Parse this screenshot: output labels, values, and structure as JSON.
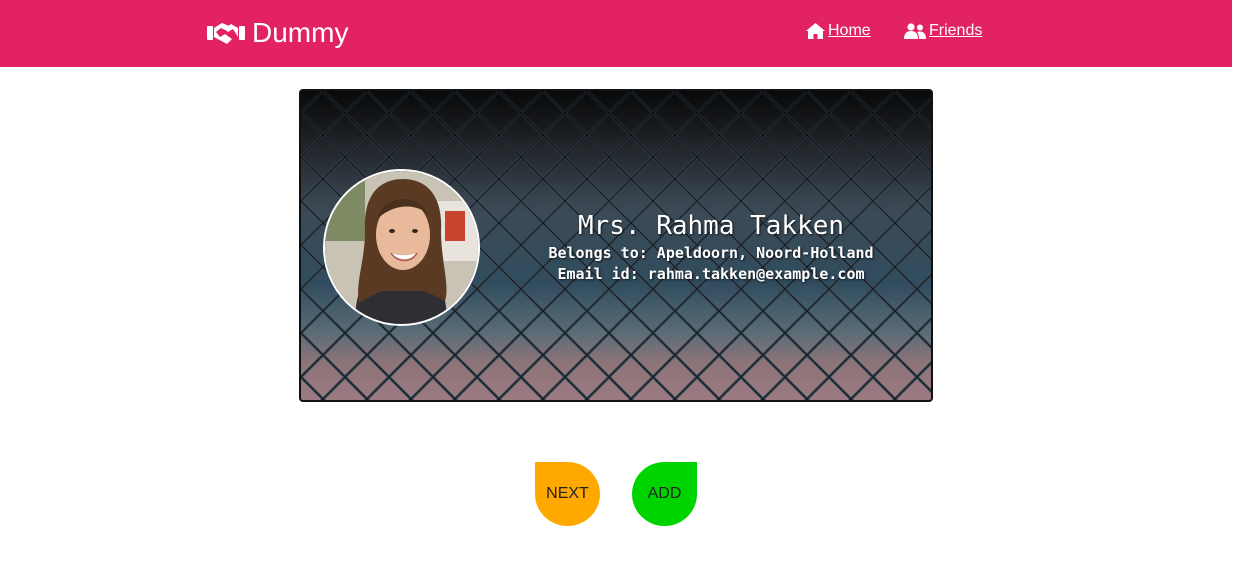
{
  "nav": {
    "brand_icon": "handshake-icon",
    "brand": "Dummy",
    "links": [
      {
        "icon": "home-icon",
        "label": " Home"
      },
      {
        "icon": "friends-icon",
        "label": " Friends"
      }
    ]
  },
  "profile": {
    "name": "Mrs. Rahma Takken",
    "location": "Belongs to: Apeldoorn, Noord-Holland",
    "email": "Email id: rahma.takken@example.com"
  },
  "actions": {
    "next_label": "NEXT",
    "add_label": "ADD"
  },
  "colors": {
    "navbar": "#e22261",
    "next_button": "#ffa800",
    "add_button": "#00d400"
  }
}
